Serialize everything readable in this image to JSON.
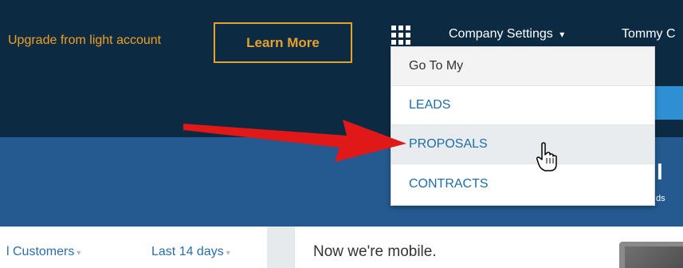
{
  "header": {
    "upgrade_text": "Upgrade from light account",
    "learn_more_label": "Learn More",
    "company_settings_label": "Company Settings",
    "company_settings_caret": "▾",
    "user_label": "Tommy C"
  },
  "dropdown": {
    "header": "Go To My",
    "items": [
      "LEADS",
      "PROPOSALS",
      "CONTRACTS"
    ]
  },
  "hero": {
    "big_glyph": "l",
    "subtext": "ds"
  },
  "filters": {
    "customers_label": "l Customers",
    "days_label": "Last 14 days",
    "caret": "▾"
  },
  "mobile": {
    "text": "Now we're mobile."
  },
  "colors": {
    "topbar": "#0c2b43",
    "hero": "#245a8f",
    "accent_orange": "#e7a12a",
    "link_blue": "#1f6da6",
    "arrow_red": "#e01818"
  },
  "icons": {
    "apps": "apps-grid-icon",
    "arrow": "red-arrow-annotation",
    "cursor": "hand-pointer-cursor"
  }
}
